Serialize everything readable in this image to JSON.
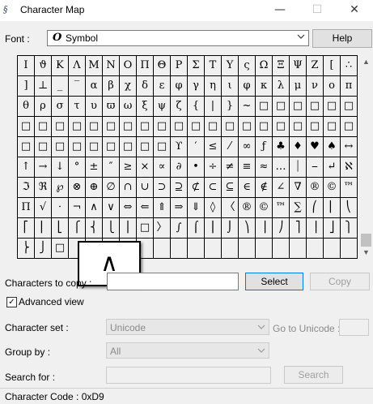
{
  "window": {
    "title": "Character Map",
    "app_icon": "§",
    "minimize_glyph": "—",
    "maximize_glyph": "☐",
    "close_glyph": "✕"
  },
  "font_row": {
    "label": "Font :",
    "selected_font": "Symbol",
    "font_glyph": "O",
    "help_label": "Help"
  },
  "grid": {
    "rows": [
      [
        "I",
        "ϑ",
        "K",
        "Λ",
        "M",
        "N",
        "O",
        "Π",
        "Θ",
        "P",
        "Σ",
        "T",
        "Y",
        "ς",
        "Ω",
        "Ξ",
        "Ψ",
        "Z",
        "[",
        "∴"
      ],
      [
        "]",
        "⊥",
        "_",
        "‾",
        "α",
        "β",
        "χ",
        "δ",
        "ε",
        "φ",
        "γ",
        "η",
        "ι",
        "φ",
        "κ",
        "λ",
        "μ",
        "ν",
        "ο",
        "π"
      ],
      [
        "θ",
        "ρ",
        "σ",
        "τ",
        "υ",
        "ϖ",
        "ω",
        "ξ",
        "ψ",
        "ζ",
        "{",
        "|",
        "}",
        "~",
        "□",
        "□",
        "□",
        "□",
        "□",
        "□"
      ],
      [
        "□",
        "□",
        "□",
        "□",
        "□",
        "□",
        "□",
        "□",
        "□",
        "□",
        "□",
        "□",
        "□",
        "□",
        "□",
        "□",
        "□",
        "□",
        "□",
        "□"
      ],
      [
        "□",
        "□",
        "□",
        "□",
        "□",
        "□",
        "□",
        "□",
        "□",
        "ϒ",
        "′",
        "≤",
        "⁄",
        "∞",
        "ƒ",
        "♣",
        "♦",
        "♥",
        "♠",
        "↔",
        "←"
      ],
      [
        "↑",
        "→",
        "↓",
        "°",
        "±",
        "″",
        "≥",
        "×",
        "∝",
        "∂",
        "•",
        "÷",
        "≠",
        "≡",
        "≈",
        "…",
        "⏐",
        "⎯",
        "↵",
        "ℵ"
      ],
      [
        "ℑ",
        "ℜ",
        "℘",
        "⊗",
        "⊕",
        "∅",
        "∩",
        "∪",
        "⊃",
        "⊇",
        "⊄",
        "⊂",
        "⊆",
        "∈",
        "∉",
        "∠",
        "∇",
        "®",
        "©",
        "™"
      ],
      [
        "Π",
        "√",
        "⋅",
        "¬",
        "∧",
        "∨",
        "⇔",
        "⇐",
        "⇑",
        "⇒",
        "⇓",
        "◊",
        "〈",
        "®",
        "©",
        "™",
        "∑",
        "⎛",
        "⎜",
        "⎝"
      ],
      [
        "⎡",
        "⎢",
        "⎣",
        "⎧",
        "⎨",
        "⎩",
        "⎪",
        "□",
        "〉",
        "∫",
        "⌠",
        "⎮",
        "⌡",
        "⎞",
        "⎟",
        "⎠",
        "⎤",
        "⎥",
        "⎦",
        "⎫"
      ],
      [
        "⎬",
        "⎭",
        "□",
        "",
        "",
        "",
        "",
        "",
        "",
        "",
        "",
        "",
        "",
        "",
        "",
        "",
        "",
        "",
        "",
        ""
      ]
    ]
  },
  "magnifier": {
    "glyph": "∧"
  },
  "copy_row": {
    "label": "Characters to copy :",
    "value": "",
    "select_label": "Select",
    "copy_label": "Copy"
  },
  "advanced": {
    "label": "Advanced view",
    "checked": "✓"
  },
  "charset_row": {
    "label": "Character set :",
    "value": "Unicode",
    "goto_label": "Go to Unicode :"
  },
  "groupby_row": {
    "label": "Group by :",
    "value": "All"
  },
  "search_row": {
    "label": "Search for :",
    "button_label": "Search"
  },
  "status": {
    "text": "Character Code : 0xD9"
  }
}
